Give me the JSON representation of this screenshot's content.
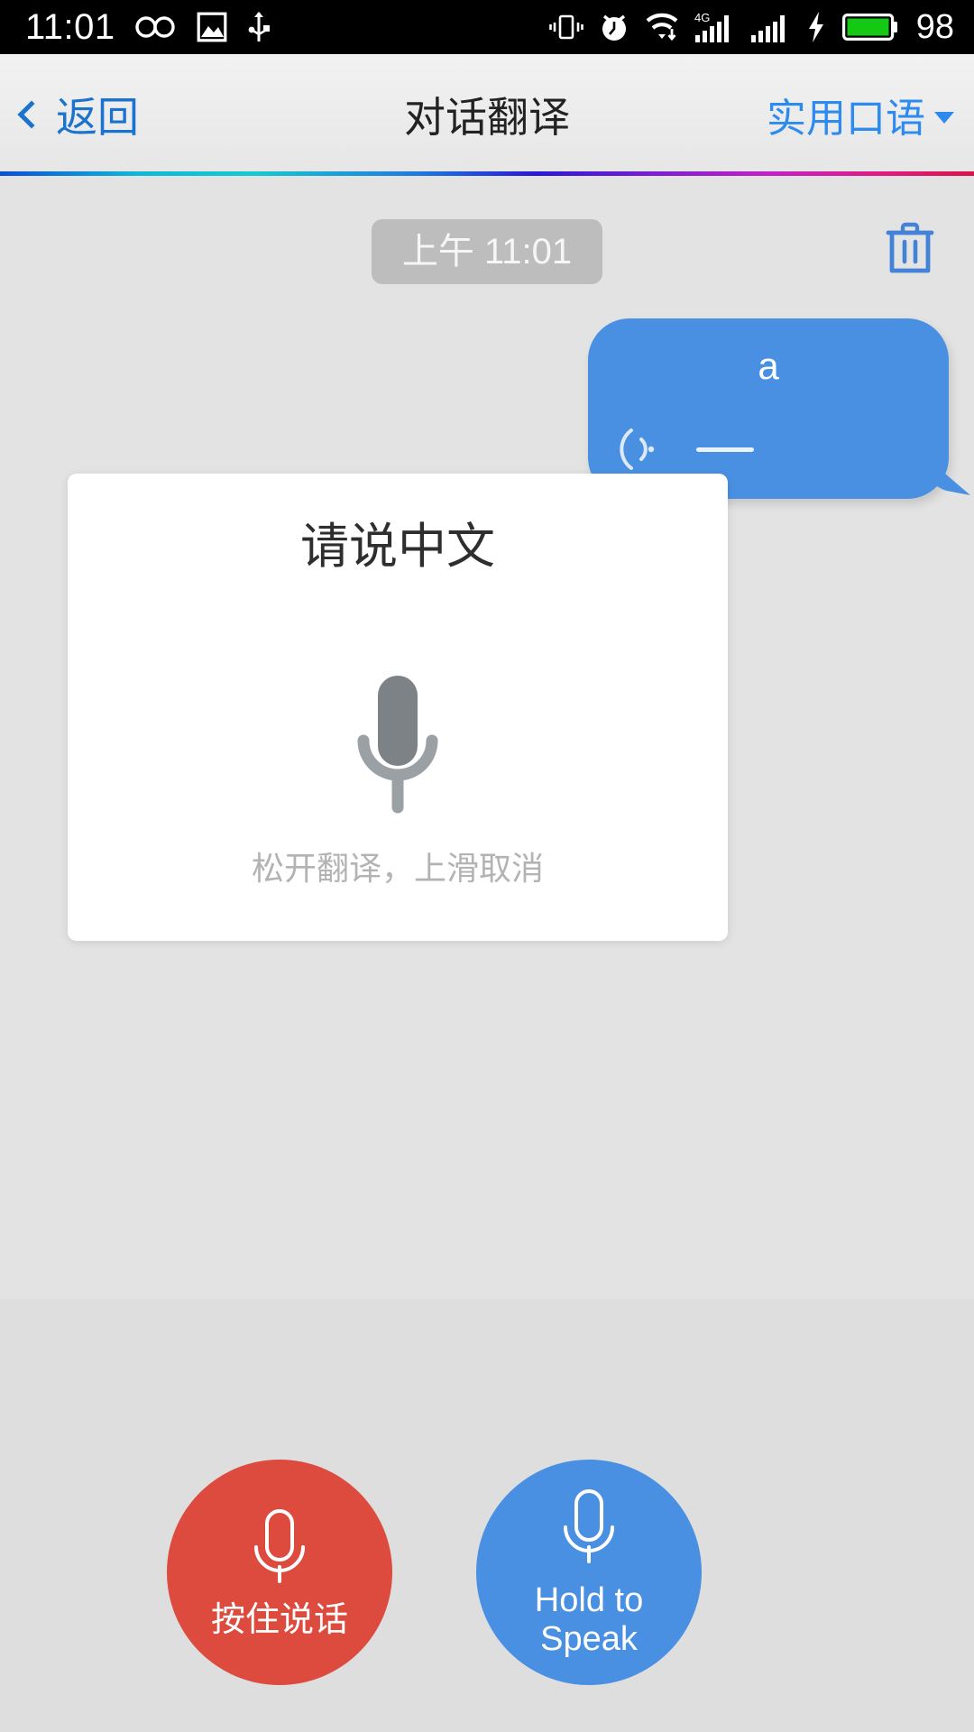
{
  "status_bar": {
    "clock": "11:01",
    "battery_percent": "98",
    "icons": [
      "infinity-icon",
      "image-icon",
      "usb-icon",
      "vibrate-icon",
      "alarm-clock-icon",
      "wifi-download-icon",
      "signal-4g-icon",
      "signal-bars-icon",
      "charging-bolt-icon",
      "battery-icon"
    ]
  },
  "nav_bar": {
    "back_label": "返回",
    "back_icon": "chevron-left-icon",
    "title": "对话翻译",
    "right_label": "实用口语",
    "right_icon": "chevron-down-icon"
  },
  "divider_gradient": [
    "#0b4fd6",
    "#16c9cf",
    "#2a18d6",
    "#7b1fd2",
    "#c421c8",
    "#d8154a"
  ],
  "chat": {
    "timestamp": "上午 11:01",
    "delete_icon": "trash-icon",
    "messages": [
      {
        "text": "a",
        "side": "right",
        "bubble_color": "#4a90e2",
        "audio_icon": "sound-wave-icon",
        "waveform": "dash"
      }
    ]
  },
  "recording_card": {
    "title": "请说中文",
    "mic_icon": "microphone-icon",
    "mic_color": "#7c8286",
    "hint": "松开翻译，上滑取消"
  },
  "bottom_bar": {
    "buttons": [
      {
        "label": "按住说话",
        "icon": "microphone-outline-icon",
        "color": "#dc4b3e",
        "name": "hold-to-speak-chinese"
      },
      {
        "label_line1": "Hold to",
        "label_line2": "Speak",
        "icon": "microphone-outline-icon",
        "color": "#4a90e2",
        "name": "hold-to-speak-english"
      }
    ]
  }
}
